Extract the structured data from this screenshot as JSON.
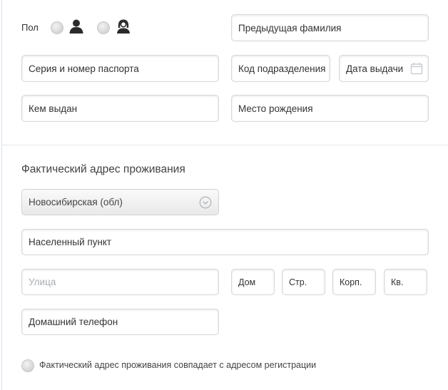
{
  "gender": {
    "label": "Пол",
    "male_icon": "male-person-icon",
    "female_icon": "female-person-icon"
  },
  "passport": {
    "previous_surname_placeholder": "Предыдущая фамилия",
    "series_number_placeholder": "Серия и номер паспорта",
    "division_code_placeholder": "Код подразделения",
    "issue_date_placeholder": "Дата выдачи",
    "issued_by_placeholder": "Кем выдан",
    "birthplace_placeholder": "Место рождения"
  },
  "address": {
    "section_title": "Фактический адрес проживания",
    "region_value": "Новосибирская (обл)",
    "locality_placeholder": "Населенный пункт",
    "street_placeholder": "Улица",
    "house_placeholder": "Дом",
    "building_placeholder": "Стр.",
    "block_placeholder": "Корп.",
    "apartment_placeholder": "Кв.",
    "home_phone_placeholder": "Домашний телефон",
    "same_as_registration_label": "Фактический адрес проживания совпадает с адресом регистрации"
  },
  "colors": {
    "border": "#d4d7db",
    "placeholder_muted": "#a9adb2",
    "text": "#333333"
  }
}
